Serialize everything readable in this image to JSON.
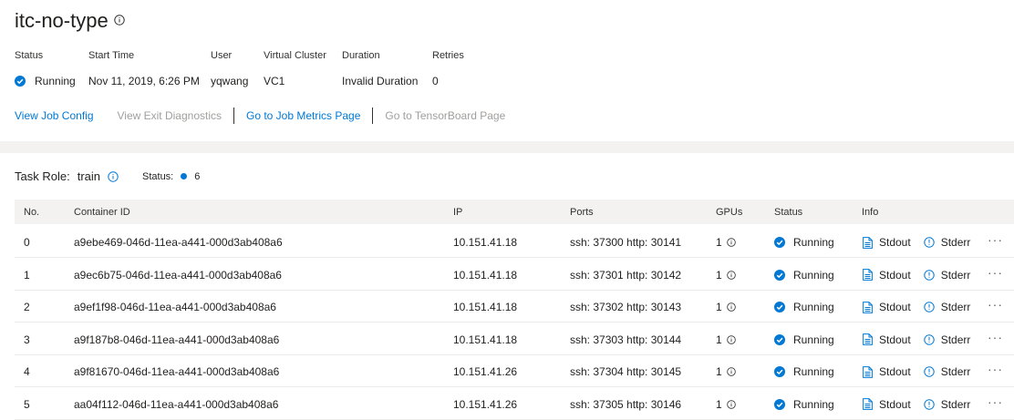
{
  "job": {
    "title": "itc-no-type",
    "meta": [
      {
        "label": "Status",
        "value": "Running"
      },
      {
        "label": "Start Time",
        "value": "Nov 11, 2019, 6:26 PM"
      },
      {
        "label": "User",
        "value": "yqwang"
      },
      {
        "label": "Virtual Cluster",
        "value": "VC1"
      },
      {
        "label": "Duration",
        "value": "Invalid Duration"
      },
      {
        "label": "Retries",
        "value": "0"
      }
    ],
    "links": {
      "view_config": "View Job Config",
      "exit_diagnostics": "View Exit Diagnostics",
      "job_metrics": "Go to Job Metrics Page",
      "tensorboard": "Go to TensorBoard Page"
    }
  },
  "task_role": {
    "label": "Task Role:",
    "name": "train",
    "status_label": "Status:",
    "running_count": "6"
  },
  "table": {
    "headers": [
      "No.",
      "Container ID",
      "IP",
      "Ports",
      "GPUs",
      "Status",
      "Info"
    ],
    "rows": [
      {
        "no": "0",
        "container": "a9ebe469-046d-11ea-a441-000d3ab408a6",
        "ip": "10.151.41.18",
        "ports": "ssh: 37300  http: 30141",
        "gpus": "1",
        "status": "Running",
        "stdout": "Stdout",
        "stderr": "Stderr"
      },
      {
        "no": "1",
        "container": "a9ec6b75-046d-11ea-a441-000d3ab408a6",
        "ip": "10.151.41.18",
        "ports": "ssh: 37301  http: 30142",
        "gpus": "1",
        "status": "Running",
        "stdout": "Stdout",
        "stderr": "Stderr"
      },
      {
        "no": "2",
        "container": "a9ef1f98-046d-11ea-a441-000d3ab408a6",
        "ip": "10.151.41.18",
        "ports": "ssh: 37302  http: 30143",
        "gpus": "1",
        "status": "Running",
        "stdout": "Stdout",
        "stderr": "Stderr"
      },
      {
        "no": "3",
        "container": "a9f187b8-046d-11ea-a441-000d3ab408a6",
        "ip": "10.151.41.18",
        "ports": "ssh: 37303  http: 30144",
        "gpus": "1",
        "status": "Running",
        "stdout": "Stdout",
        "stderr": "Stderr"
      },
      {
        "no": "4",
        "container": "a9f81670-046d-11ea-a441-000d3ab408a6",
        "ip": "10.151.41.26",
        "ports": "ssh: 37304  http: 30145",
        "gpus": "1",
        "status": "Running",
        "stdout": "Stdout",
        "stderr": "Stderr"
      },
      {
        "no": "5",
        "container": "aa04f112-046d-11ea-a441-000d3ab408a6",
        "ip": "10.151.41.26",
        "ports": "ssh: 37305  http: 30146",
        "gpus": "1",
        "status": "Running",
        "stdout": "Stdout",
        "stderr": "Stderr"
      }
    ]
  },
  "icons": {
    "title_info": "info-icon",
    "status": "check-circle-icon",
    "gpu_info": "info-icon",
    "stdout": "document-icon",
    "stderr": "info-icon",
    "row_menu": "more-icon"
  },
  "colors": {
    "accent": "#0078d4",
    "disabled_link": "#a19f9d",
    "band": "#f3f2f1"
  }
}
